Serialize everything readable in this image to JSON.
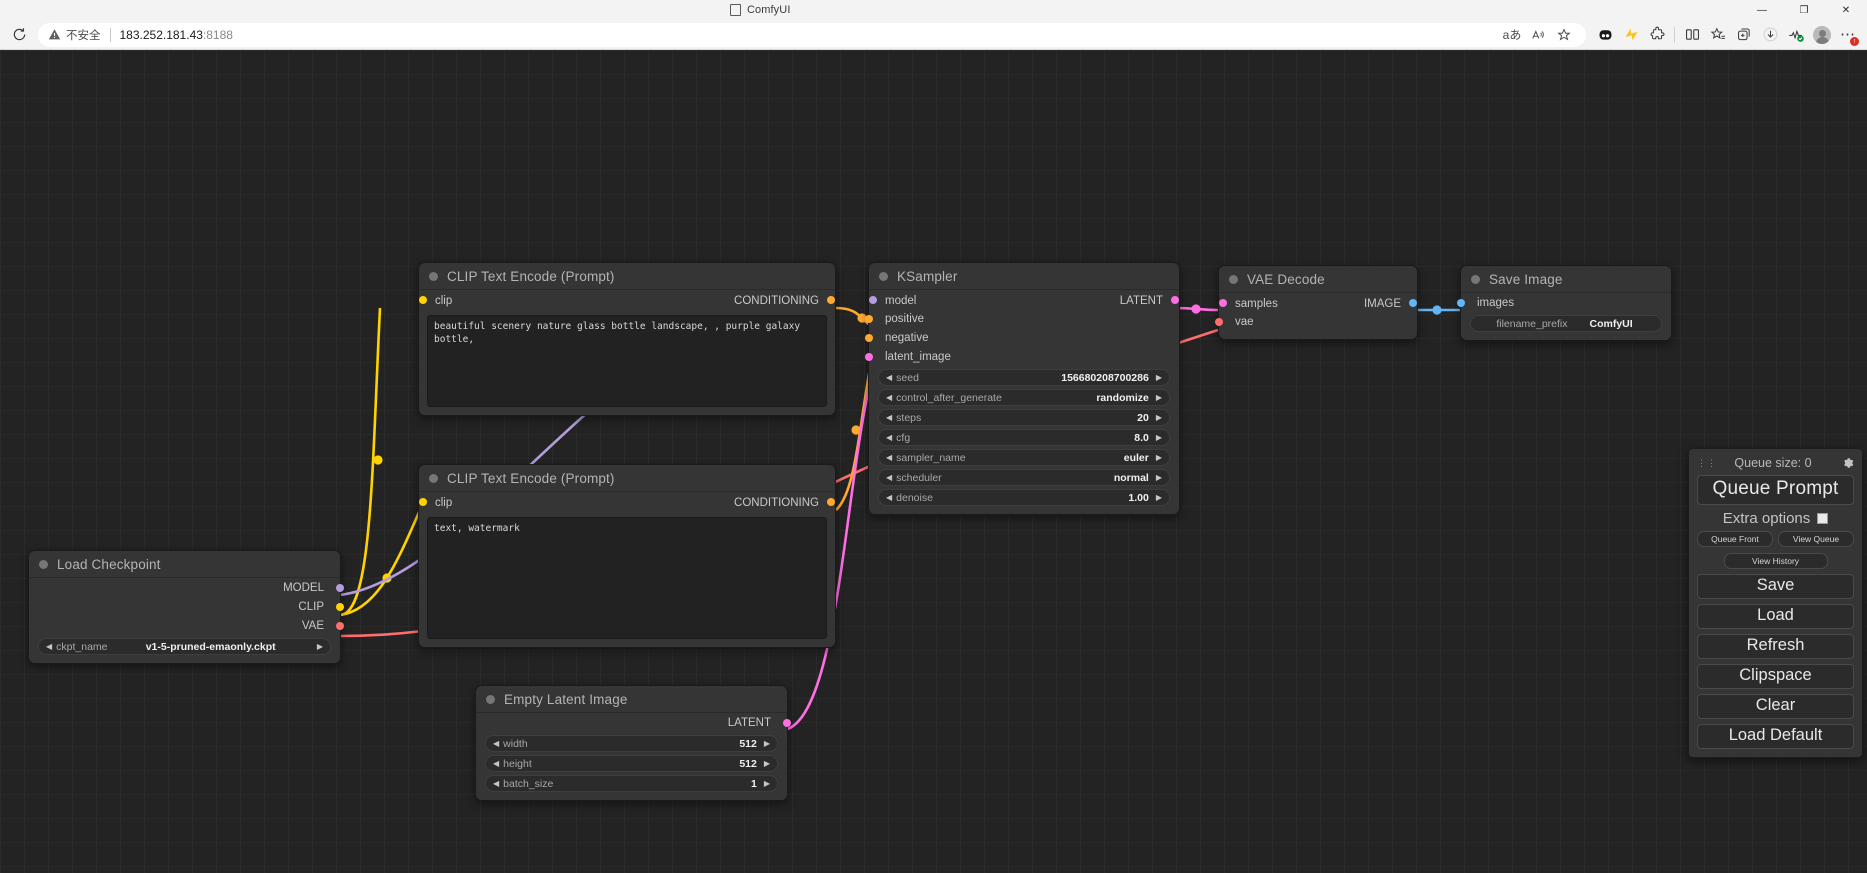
{
  "browser": {
    "tab_title": "ComfyUI",
    "tab_favicon_icon": "page-icon",
    "window_controls": [
      {
        "name": "minimize-button",
        "glyph": "—"
      },
      {
        "name": "maximize-button",
        "glyph": "❐"
      },
      {
        "name": "close-button",
        "glyph": "✕"
      }
    ],
    "reload_icon": "reload-icon",
    "security_warning": "不安全",
    "url": "183.252.181.43",
    "url_port": ":8188",
    "omnibox_icons": [
      {
        "name": "translate-icon",
        "glyph": "aあ"
      },
      {
        "name": "read-aloud-icon",
        "glyph": "A"
      },
      {
        "name": "favorite-star-icon",
        "glyph": "☆"
      }
    ],
    "toolbar_icons": [
      {
        "name": "copilot-icon"
      },
      {
        "name": "performance-icon"
      },
      {
        "name": "extensions-icon"
      },
      {
        "name": "split-screen-icon"
      },
      {
        "name": "favorites-icon"
      },
      {
        "name": "collections-icon"
      },
      {
        "name": "downloads-icon"
      },
      {
        "name": "browser-essentials-icon"
      },
      {
        "name": "profile-avatar"
      },
      {
        "name": "settings-more-icon"
      }
    ],
    "more_badge": "↑"
  },
  "nodes": {
    "clip_positive": {
      "title": "CLIP Text Encode (Prompt)",
      "input": {
        "label": "clip",
        "color": "#FFD300"
      },
      "output": {
        "label": "CONDITIONING",
        "color": "#FFA931"
      },
      "text": "beautiful scenery nature glass bottle landscape, , purple galaxy bottle,"
    },
    "clip_negative": {
      "title": "CLIP Text Encode (Prompt)",
      "input": {
        "label": "clip",
        "color": "#FFD300"
      },
      "output": {
        "label": "CONDITIONING",
        "color": "#FFA931"
      },
      "text": "text, watermark"
    },
    "ksampler": {
      "title": "KSampler",
      "inputs": [
        {
          "label": "model",
          "color": "#B39DDB"
        },
        {
          "label": "positive",
          "color": "#FFA931"
        },
        {
          "label": "negative",
          "color": "#FFA931"
        },
        {
          "label": "latent_image",
          "color": "#FF6EE3"
        }
      ],
      "outputs": [
        {
          "label": "LATENT",
          "color": "#FF6EE3"
        }
      ],
      "widgets": [
        {
          "name": "seed",
          "value": "156680208700286"
        },
        {
          "name": "control_after_generate",
          "value": "randomize"
        },
        {
          "name": "steps",
          "value": "20"
        },
        {
          "name": "cfg",
          "value": "8.0"
        },
        {
          "name": "sampler_name",
          "value": "euler"
        },
        {
          "name": "scheduler",
          "value": "normal"
        },
        {
          "name": "denoise",
          "value": "1.00"
        }
      ]
    },
    "vae_decode": {
      "title": "VAE Decode",
      "inputs": [
        {
          "label": "samples",
          "color": "#FF6EE3"
        },
        {
          "label": "vae",
          "color": "#FF6E6E"
        }
      ],
      "outputs": [
        {
          "label": "IMAGE",
          "color": "#64B5F6"
        }
      ]
    },
    "save_image": {
      "title": "Save Image",
      "inputs": [
        {
          "label": "images",
          "color": "#64B5F6"
        }
      ],
      "widgets": [
        {
          "name": "filename_prefix",
          "value": "ComfyUI"
        }
      ]
    },
    "load_checkpoint": {
      "title": "Load Checkpoint",
      "outputs": [
        {
          "label": "MODEL",
          "color": "#B39DDB"
        },
        {
          "label": "CLIP",
          "color": "#FFD300"
        },
        {
          "label": "VAE",
          "color": "#FF6E6E"
        }
      ],
      "widgets": [
        {
          "name": "ckpt_name",
          "value": "v1-5-pruned-emaonly.ckpt"
        }
      ]
    },
    "empty_latent": {
      "title": "Empty Latent Image",
      "outputs": [
        {
          "label": "LATENT",
          "color": "#FF6EE3"
        }
      ],
      "widgets": [
        {
          "name": "width",
          "value": "512"
        },
        {
          "name": "height",
          "value": "512"
        },
        {
          "name": "batch_size",
          "value": "1"
        }
      ]
    }
  },
  "menu": {
    "grip_icon": "drag-grip-icon",
    "queue_size": "Queue size: 0",
    "gear_icon": "gear-icon",
    "queue_prompt": "Queue Prompt",
    "extra_options": "Extra options",
    "queue_front": "Queue Front",
    "view_queue": "View Queue",
    "view_history": "View History",
    "save": "Save",
    "load": "Load",
    "refresh": "Refresh",
    "clipspace": "Clipspace",
    "clear": "Clear",
    "load_default": "Load Default"
  },
  "arrows": {
    "left": "◀",
    "right": "▶"
  },
  "colors": {
    "canvas_bg": "#232323",
    "node_bg": "#353535",
    "wire_clip": "#FFD300",
    "wire_cond": "#FFA931",
    "wire_model": "#B39DDB",
    "wire_latent": "#FF6EE3",
    "wire_vae": "#FF6E6E",
    "wire_image": "#64B5F6"
  }
}
